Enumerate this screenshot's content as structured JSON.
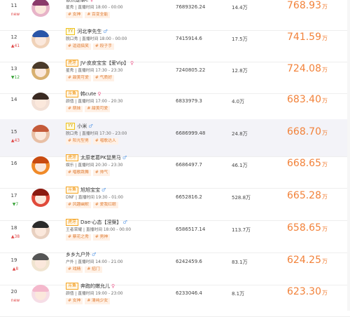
{
  "rows": [
    {
      "rank": "11",
      "trend": "new",
      "trend_type": "new",
      "platform": "",
      "name": "依然是聊e",
      "gender": "♀",
      "gender_type": "f",
      "category": "星秀",
      "time": "直播时间 18:00 - 00:00",
      "tags": [
        "女神",
        "百变全能"
      ],
      "value": "7689326.24",
      "fans": "14.4万",
      "score": "768.93",
      "unit": "万",
      "avatar_color": "#e7b3c8",
      "hair_color": "#8a3a6a"
    },
    {
      "rank": "12",
      "trend": "▲41",
      "trend_type": "up",
      "platform": "YY",
      "name": "河北李先生",
      "gender": "♂",
      "gender_type": "m",
      "category": "脱口秀",
      "time": "直播时间 18:00 - 00:00",
      "tags": [
        "逗逼搞笑",
        "段子手"
      ],
      "value": "7415914.6",
      "fans": "17.5万",
      "score": "741.59",
      "unit": "万",
      "avatar_color": "#f0d2b8",
      "hair_color": "#2a56a8"
    },
    {
      "rank": "13",
      "trend": "▼12",
      "trend_type": "down",
      "platform": "虎牙",
      "name": "JV-皮皮宝宝【爱Vip】",
      "gender": "♀",
      "gender_type": "f",
      "category": "星秀",
      "time": "直播时间 17:30 - 23:30",
      "tags": [
        "甜美可爱",
        "气质好"
      ],
      "value": "7240805.22",
      "fans": "12.8万",
      "score": "724.08",
      "unit": "万",
      "avatar_color": "#d8b070",
      "hair_color": "#4a3a2a"
    },
    {
      "rank": "14",
      "trend": "",
      "trend_type": "",
      "platform": "斗鱼",
      "name": "韩cute",
      "gender": "♀",
      "gender_type": "f",
      "category": "颜值",
      "time": "直播时间 17:00 - 20:30",
      "tags": [
        "萌妹",
        "甜美可爱"
      ],
      "value": "6833979.3",
      "fans": "4.0万",
      "score": "683.40",
      "unit": "万",
      "avatar_color": "#f2e0d6",
      "hair_color": "#3a2a22"
    },
    {
      "rank": "15",
      "trend": "▲43",
      "trend_type": "up",
      "platform": "YY",
      "name": "小米",
      "gender": "♂",
      "gender_type": "m",
      "category": "脱口秀",
      "time": "直播时间 17:30 - 23:00",
      "tags": [
        "阳光型男",
        "唱歌达人"
      ],
      "value": "6686999.48",
      "fans": "24.8万",
      "score": "668.70",
      "unit": "万",
      "avatar_color": "#e8bfa5",
      "hair_color": "#c45a3a"
    },
    {
      "rank": "16",
      "trend": "",
      "trend_type": "",
      "platform": "虎牙",
      "name": "太原老葛PK鼠黑马",
      "gender": "♂",
      "gender_type": "m",
      "category": "娱乐",
      "time": "直播时间 20:30 - 23:30",
      "tags": [
        "唱歌跳舞",
        "帅气"
      ],
      "value": "6686497.7",
      "fans": "46.1万",
      "score": "668.65",
      "unit": "万",
      "avatar_color": "#f08a28",
      "hair_color": "#c84a10"
    },
    {
      "rank": "17",
      "trend": "▼7",
      "trend_type": "down",
      "platform": "斗鱼",
      "name": "旭旭宝宝",
      "gender": "♂",
      "gender_type": "m",
      "category": "DNF",
      "time": "直播时间 19:30 - 01:00",
      "tags": [
        "风趣幽默",
        "爱我红眼"
      ],
      "value": "6652816.2",
      "fans": "528.8万",
      "score": "665.28",
      "unit": "万",
      "avatar_color": "#e04a3a",
      "hair_color": "#8a1a10"
    },
    {
      "rank": "18",
      "trend": "▲38",
      "trend_type": "up",
      "platform": "虎牙",
      "name": "Dae-心态【涅槃】",
      "gender": "♂",
      "gender_type": "m",
      "category": "王者荣耀",
      "time": "直播时间 18:00 - 00:00",
      "tags": [
        "蔡花之秀",
        "男神"
      ],
      "value": "6586517.14",
      "fans": "113.7万",
      "score": "658.65",
      "unit": "万",
      "avatar_color": "#e8d0c0",
      "hair_color": "#2a2a2a"
    },
    {
      "rank": "19",
      "trend": "▲8",
      "trend_type": "up",
      "platform": "",
      "name": "乡乡九户外",
      "gender": "♂",
      "gender_type": "m",
      "category": "户外",
      "time": "直播时间 14:00 - 21:00",
      "tags": [
        "戏精",
        "招门"
      ],
      "value": "6242459.6",
      "fans": "83.1万",
      "score": "624.25",
      "unit": "万",
      "avatar_color": "#f0e4d0",
      "hair_color": "#555555"
    },
    {
      "rank": "20",
      "trend": "new",
      "trend_type": "new",
      "platform": "斗鱼",
      "name": "奔跑的嫩允儿",
      "gender": "♀",
      "gender_type": "f",
      "category": "颜值",
      "time": "直播时间 19:00 - 23:00",
      "tags": [
        "女神",
        "清纯少女"
      ],
      "value": "6233046.4",
      "fans": "8.1万",
      "score": "623.30",
      "unit": "万",
      "avatar_color": "#f6dde6",
      "hair_color": "#f4b8cc"
    }
  ]
}
